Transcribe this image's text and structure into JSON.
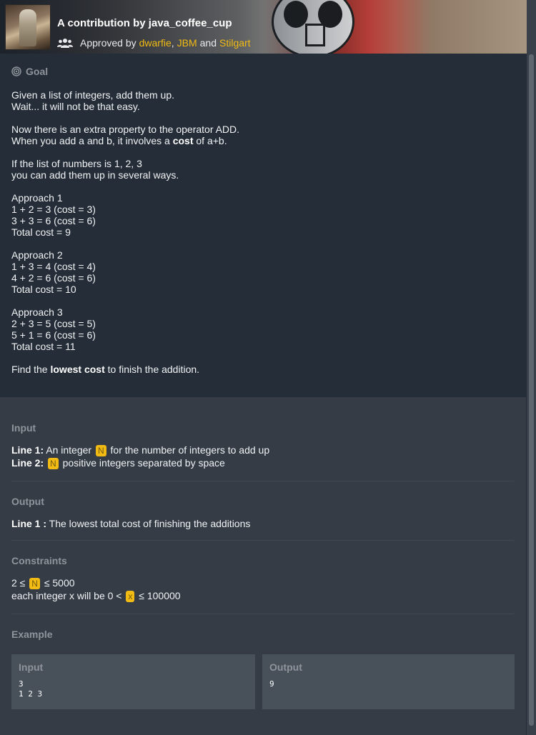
{
  "header": {
    "title": "A contribution by java_coffee_cup",
    "approved_prefix": "Approved by",
    "approvers": [
      "dwarfie",
      "JBM",
      "Stilgart"
    ],
    "sep_comma": ",",
    "sep_and": "and",
    "accent_color": "#f2bb13"
  },
  "goal": {
    "heading": "Goal",
    "lines": [
      "Given a list of integers, add them up.",
      "Wait... it will not be that easy.",
      "",
      "Now there is an extra property to the operator ADD.",
      "When you add a and b, it involves a |cost| of a+b.",
      "",
      "If the list of numbers is 1, 2, 3",
      "you can add them up in several ways.",
      "",
      "Approach 1",
      "1 + 2 = 3 (cost = 3)",
      "3 + 3 = 6 (cost = 6)",
      "Total cost = 9",
      "",
      "Approach 2",
      "1 + 3 = 4 (cost = 4)",
      "4 + 2 = 6 (cost = 6)",
      "Total cost = 10",
      "",
      "Approach 3",
      "2 + 3 = 5 (cost = 5)",
      "5 + 1 = 6 (cost = 6)",
      "Total cost = 11",
      "",
      "Find the |lowest cost| to finish the addition."
    ]
  },
  "input": {
    "heading": "Input",
    "line1_label": "Line 1:",
    "line1_pre": "An integer",
    "line1_var": "N",
    "line1_post": "for the number of integers to add up",
    "line2_label": "Line 2:",
    "line2_var": "N",
    "line2_post": "positive integers separated by space"
  },
  "output": {
    "heading": "Output",
    "line1_label": "Line 1 :",
    "line1_text": "The lowest total cost of finishing the additions"
  },
  "constraints": {
    "heading": "Constraints",
    "c1_pre": "2 ≤",
    "c1_var": "N",
    "c1_post": "≤ 5000",
    "c2_pre": "each integer x will be 0 <",
    "c2_var": "x",
    "c2_post": "≤ 100000"
  },
  "example": {
    "heading": "Example",
    "input_label": "Input",
    "input_value": "3\n1 2 3",
    "output_label": "Output",
    "output_value": "9"
  }
}
